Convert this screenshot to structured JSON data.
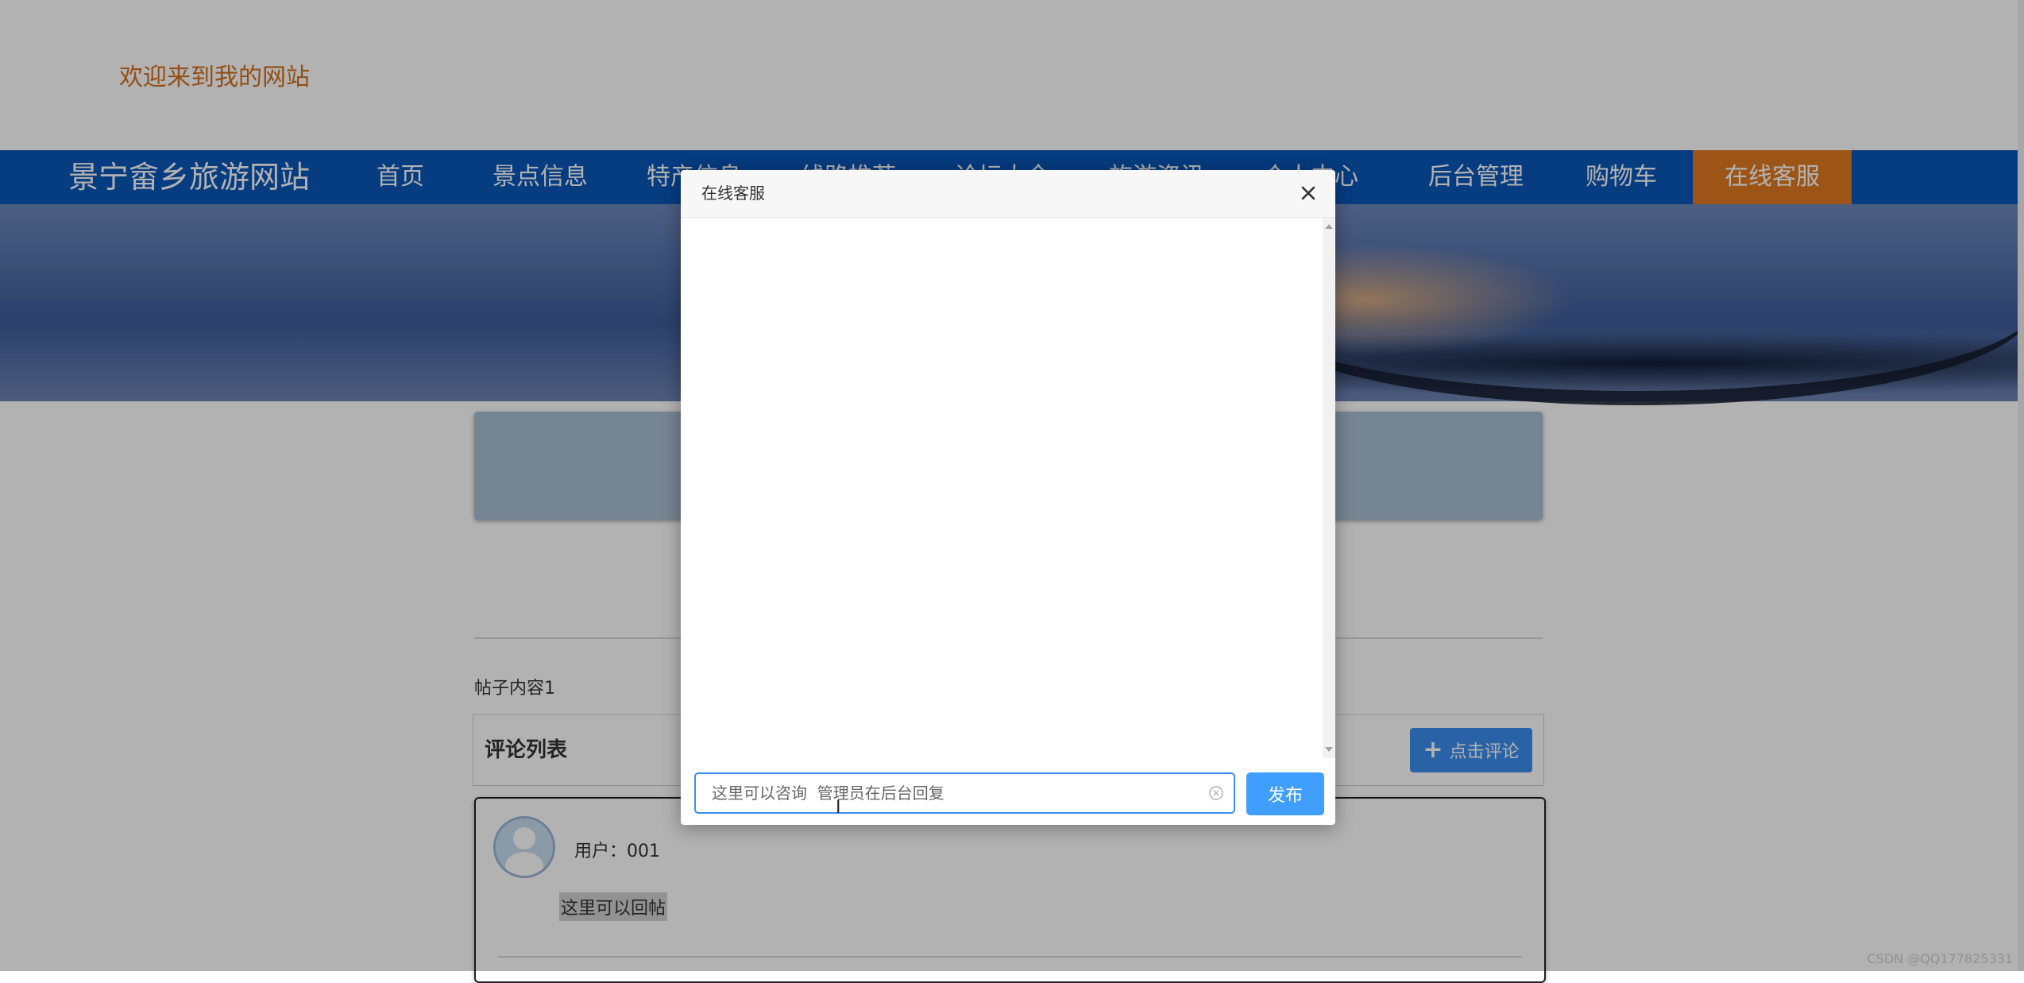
{
  "header": {
    "welcome_text": "欢迎来到我的网站"
  },
  "nav": {
    "site_title": "景宁畲乡旅游网站",
    "items": [
      "首页",
      "景点信息",
      "特产信息",
      "线路推荐",
      "论坛大全",
      "旅游资讯",
      "个人中心",
      "后台管理",
      "购物车",
      "在线客服"
    ],
    "active_item": "在线客服"
  },
  "post": {
    "content": "帖子内容1"
  },
  "comments": {
    "title": "评论列表",
    "add_button_label": "点击评论",
    "items": [
      {
        "user": "用户：001",
        "text": "这里可以回帖"
      }
    ]
  },
  "dialog": {
    "title": "在线客服",
    "input_value": "这里可以咨询  管理员在后台回复",
    "publish_label": "发布"
  },
  "watermark": "CSDN @QQ177825331",
  "colors": {
    "nav_bg": "#0a57b8",
    "nav_active": "#e07a20",
    "welcome": "#d2711f",
    "primary": "#409eff"
  }
}
